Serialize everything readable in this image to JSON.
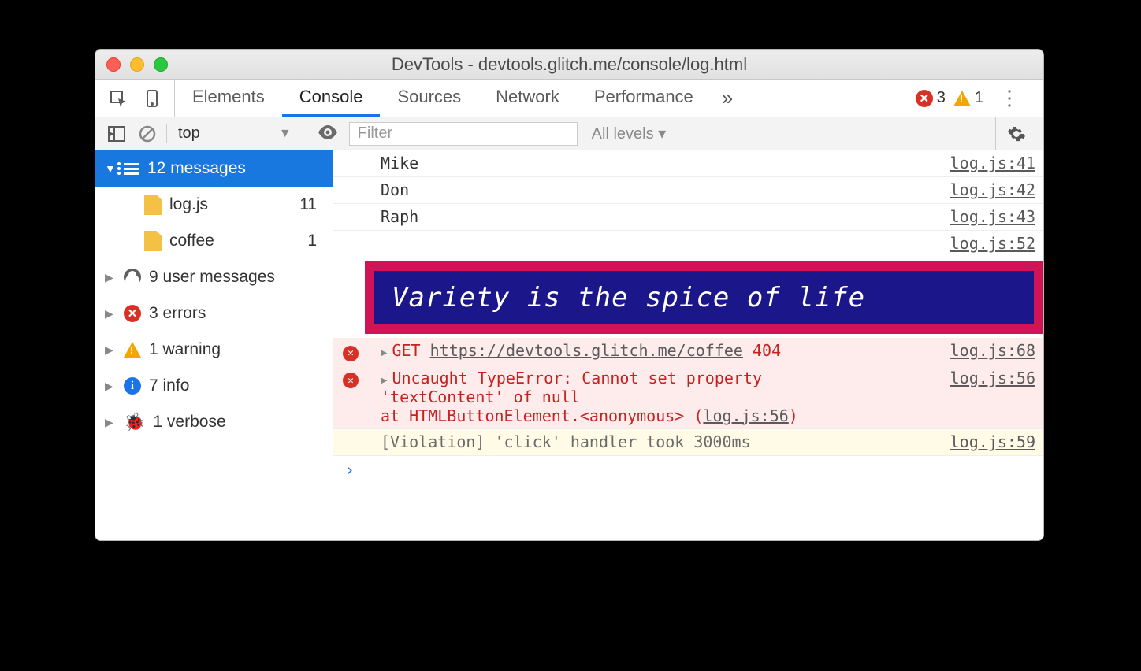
{
  "window": {
    "title": "DevTools - devtools.glitch.me/console/log.html"
  },
  "tabs": {
    "items": [
      "Elements",
      "Console",
      "Sources",
      "Network",
      "Performance"
    ],
    "more": "»",
    "errors": "3",
    "warnings": "1"
  },
  "filterbar": {
    "context": "top",
    "filter_placeholder": "Filter",
    "levels": "All levels ▾"
  },
  "sidebar": {
    "messages": {
      "label": "12 messages"
    },
    "files": [
      {
        "name": "log.js",
        "count": "11"
      },
      {
        "name": "coffee",
        "count": "1"
      }
    ],
    "groups": [
      {
        "label": "9 user messages",
        "icon": "user"
      },
      {
        "label": "3 errors",
        "icon": "error"
      },
      {
        "label": "1 warning",
        "icon": "warning"
      },
      {
        "label": "7 info",
        "icon": "info"
      },
      {
        "label": "1 verbose",
        "icon": "bug"
      }
    ]
  },
  "console": {
    "rows": [
      {
        "text": "Mike",
        "src": "log.js:41"
      },
      {
        "text": "Don",
        "src": "log.js:42"
      },
      {
        "text": "Raph",
        "src": "log.js:43"
      }
    ],
    "spice_src": "log.js:52",
    "spice": "Variety is the spice of life",
    "get_err": {
      "method": "GET",
      "url": "https://devtools.glitch.me/coffee",
      "code": "404",
      "src": "log.js:68"
    },
    "type_err": {
      "line1": "Uncaught TypeError: Cannot set property",
      "line2": "'textContent' of null",
      "line3a": "    at HTMLButtonElement.<anonymous> (",
      "line3b": "log.js:56",
      "line3c": ")",
      "src": "log.js:56"
    },
    "violation": {
      "text": "[Violation] 'click' handler took 3000ms",
      "src": "log.js:59"
    },
    "prompt": "›"
  }
}
